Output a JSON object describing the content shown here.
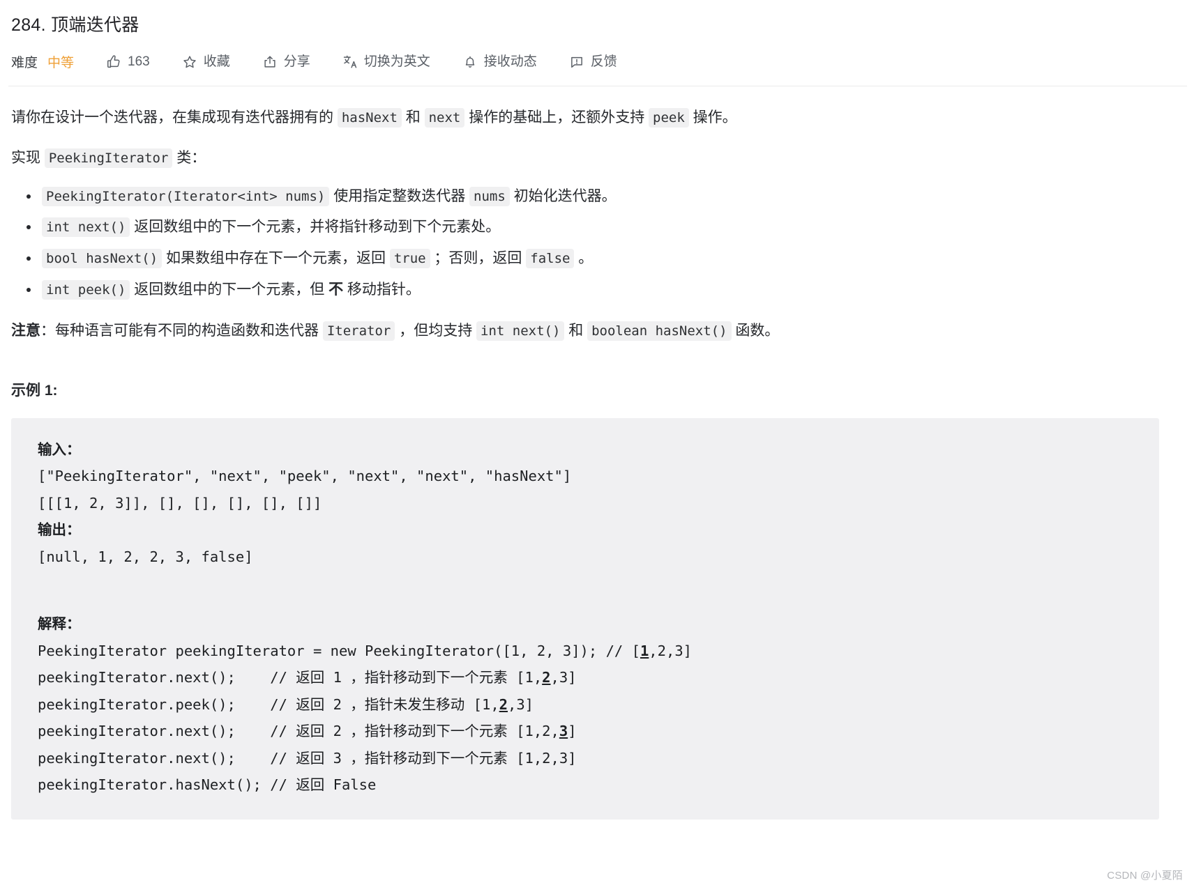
{
  "problem": {
    "title": "284. 顶端迭代器"
  },
  "toolbar": {
    "difficulty_label": "难度",
    "difficulty_value": "中等",
    "likes": "163",
    "favorite": "收藏",
    "share": "分享",
    "switch_language": "切换为英文",
    "subscribe": "接收动态",
    "feedback": "反馈",
    "icons": {
      "like": "thumbs-up-icon",
      "favorite": "star-icon",
      "share": "share-icon",
      "translate": "translate-icon",
      "bell": "bell-icon",
      "feedback": "feedback-icon"
    }
  },
  "description": {
    "intro": {
      "part1": "请你在设计一个迭代器，在集成现有迭代器拥有的 ",
      "code1": "hasNext",
      "part2": " 和 ",
      "code2": "next",
      "part3": " 操作的基础上，还额外支持 ",
      "code3": "peek",
      "part4": " 操作。"
    },
    "implement": {
      "prefix": "实现 ",
      "code": "PeekingIterator",
      "suffix": " 类："
    },
    "methods": [
      {
        "code": "PeekingIterator(Iterator<int> nums)",
        "text1": " 使用指定整数迭代器 ",
        "code2": "nums",
        "text2": " 初始化迭代器。"
      },
      {
        "code": "int next()",
        "text1": " 返回数组中的下一个元素，并将指针移动到下个元素处。"
      },
      {
        "code": "bool hasNext()",
        "text1": " 如果数组中存在下一个元素，返回 ",
        "code2": "true",
        "text2": " ；否则，返回 ",
        "code3": "false",
        "text3": " 。"
      },
      {
        "code": "int peek()",
        "text1": " 返回数组中的下一个元素，但 ",
        "bold": "不",
        "text2": " 移动指针。"
      }
    ],
    "note": {
      "label": "注意",
      "part1": "：每种语言可能有不同的构造函数和迭代器 ",
      "code1": "Iterator",
      "part2": " ，但均支持 ",
      "code2": "int next()",
      "part3": " 和 ",
      "code3": "boolean hasNext()",
      "part4": " 函数。"
    }
  },
  "example": {
    "heading": "示例 1:",
    "input_label": "输入：",
    "input_line1": "[\"PeekingIterator\", \"next\", \"peek\", \"next\", \"next\", \"hasNext\"]",
    "input_line2": "[[[1, 2, 3]], [], [], [], [], []]",
    "output_label": "输出：",
    "output_line": "[null, 1, 2, 2, 3, false]",
    "explain_label": "解释：",
    "explain_lines": [
      {
        "code": "PeekingIterator peekingIterator = new PeekingIterator([1, 2, 3]); // [",
        "mark": "1",
        "tail": ",2,3]"
      },
      {
        "code": "peekingIterator.next();    // 返回 1 ，指针移动到下一个元素 [1,",
        "mark": "2",
        "tail": ",3]"
      },
      {
        "code": "peekingIterator.peek();    // 返回 2 ，指针未发生移动 [1,",
        "mark": "2",
        "tail": ",3]"
      },
      {
        "code": "peekingIterator.next();    // 返回 2 ，指针移动到下一个元素 [1,2,",
        "mark": "3",
        "tail": "]"
      },
      {
        "code": "peekingIterator.next();    // 返回 3 ，指针移动到下一个元素 [1,2,3]",
        "mark": "",
        "tail": ""
      },
      {
        "code": "peekingIterator.hasNext(); // 返回 False",
        "mark": "",
        "tail": ""
      }
    ]
  },
  "watermark": "CSDN @小夏陌",
  "colors": {
    "difficulty": "#efa037",
    "code_bg": "#f0f0f1",
    "block_bg": "#f0f0f2",
    "text": "#26282c"
  }
}
